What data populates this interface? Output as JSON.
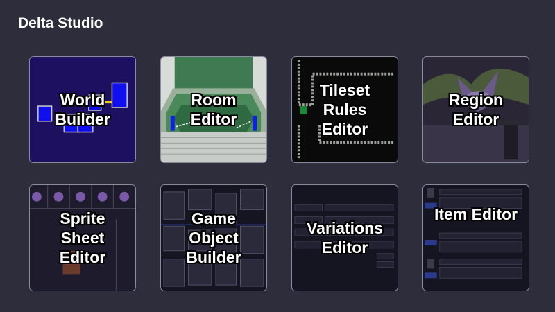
{
  "app": {
    "title": "Delta Studio"
  },
  "tools": [
    {
      "id": "world-builder",
      "label": "World\nBuilder"
    },
    {
      "id": "room-editor",
      "label": "Room\nEditor"
    },
    {
      "id": "tileset-rules-editor",
      "label": "Tileset\nRules\nEditor"
    },
    {
      "id": "region-editor",
      "label": "Region\nEditor"
    },
    {
      "id": "sprite-sheet-editor",
      "label": "Sprite\nSheet\nEditor"
    },
    {
      "id": "game-object-builder",
      "label": "Game\nObject\nBuilder"
    },
    {
      "id": "variations-editor",
      "label": "Variations\nEditor"
    },
    {
      "id": "item-editor",
      "label": "Item Editor"
    }
  ],
  "colors": {
    "background": "#2e2d3b",
    "tile_border": "#8a8aa0"
  }
}
